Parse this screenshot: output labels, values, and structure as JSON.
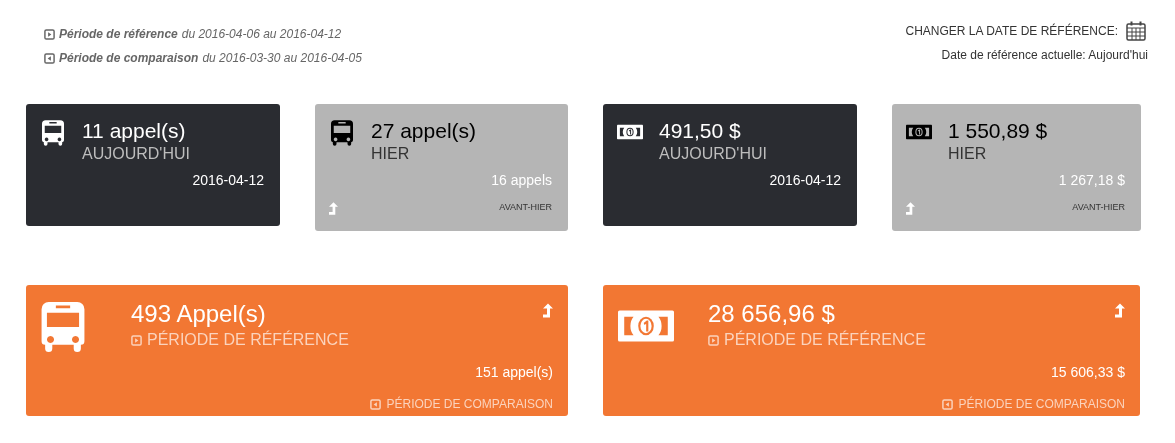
{
  "period_legend": [
    {
      "kind": "reference",
      "label": "Période de référence",
      "range": "du 2016-04-06 au 2016-04-12"
    },
    {
      "kind": "comparison",
      "label": "Période de comparaison",
      "range": "du 2016-03-30 au 2016-04-05"
    }
  ],
  "reference_date": {
    "action": "CHANGER LA DATE DE RÉFÉRENCE:",
    "current": "Date de référence actuelle: Aujourd'hui"
  },
  "cards": [
    {
      "kind": "calls",
      "highlighted": true,
      "value": "11 appel(s)",
      "label": "AUJOURD'HUI",
      "detail": "2016-04-12"
    },
    {
      "kind": "calls",
      "highlighted": false,
      "value": "27 appel(s)",
      "label": "HIER",
      "detail": "16 appels",
      "footer": "AVANT-HIER"
    },
    {
      "kind": "revenue",
      "highlighted": true,
      "value": "491,50 $",
      "label": "AUJOURD'HUI",
      "detail": "2016-04-12"
    },
    {
      "kind": "revenue",
      "highlighted": false,
      "value": "1 550,89 $",
      "label": "HIER",
      "detail": "1 267,18 $",
      "footer": "AVANT-HIER"
    }
  ],
  "summary_cards": [
    {
      "kind": "calls",
      "value": "493 Appel(s)",
      "reference_label": "PÉRIODE DE RÉFÉRENCE",
      "comparison_value": "151 appel(s)",
      "comparison_label": "PÉRIODE DE COMPARAISON"
    },
    {
      "kind": "revenue",
      "value": "28 656,96 $",
      "reference_label": "PÉRIODE DE RÉFÉRENCE",
      "comparison_value": "15 606,33 $",
      "comparison_label": "PÉRIODE DE COMPARAISON"
    }
  ]
}
